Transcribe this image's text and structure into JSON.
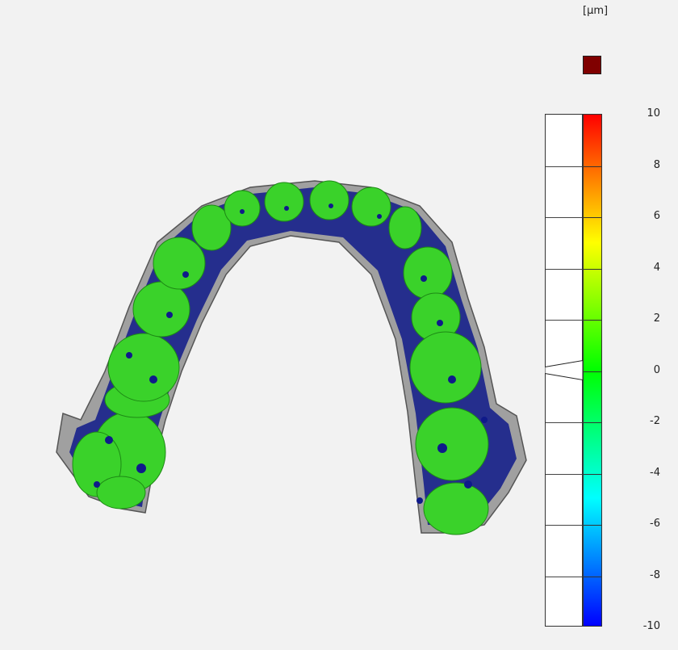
{
  "legend": {
    "unit": "[µm]",
    "out_of_range_color": "#800000",
    "scale_values": [
      "10",
      "8",
      "6",
      "4",
      "2",
      "0",
      "-2",
      "-4",
      "-6",
      "-8",
      "-10"
    ],
    "min": -10,
    "max": 10,
    "histogram_peak_value": 0,
    "colormap": [
      "#ff0000",
      "#ff8000",
      "#ffff00",
      "#80ff00",
      "#00ff00",
      "#00ff80",
      "#00ffff",
      "#0080ff",
      "#0000ff"
    ]
  },
  "model": {
    "surface_color": "#3ad22a",
    "undercut_color": "#0f1a8a",
    "base_color": "#9a9a9a",
    "icon": "dental-arch-scan"
  }
}
